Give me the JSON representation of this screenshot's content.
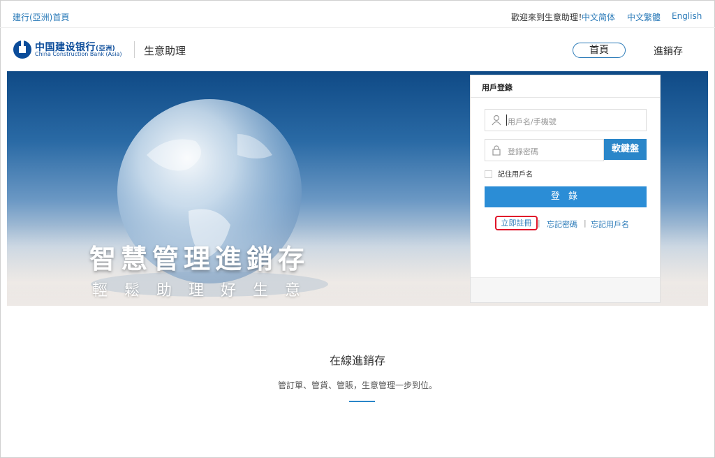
{
  "topbar": {
    "home_link": "建行(亞洲)首頁",
    "welcome": "歡迎來到生意助理！",
    "languages": [
      "中文简体",
      "中文繁體",
      "English"
    ]
  },
  "header": {
    "logo_cn": "中国建设银行",
    "logo_cn_suffix": "(亞洲)",
    "logo_en": "China Construction Bank (Asia)",
    "app_name": "生意助理",
    "nav": [
      "首頁",
      "進銷存"
    ]
  },
  "banner": {
    "title": "智慧管理進銷存",
    "subtitle": "輕鬆助理好生意"
  },
  "login": {
    "title": "用戶登錄",
    "username_placeholder": "用戶名/手機號",
    "password_placeholder": "登錄密碼",
    "virtual_keyboard": "軟鍵盤",
    "remember": "記住用戶名",
    "submit": "登 錄",
    "register": "立即註冊",
    "forgot_password": "忘記密碼",
    "forgot_username": "忘記用戶名",
    "separator": "|"
  },
  "section": {
    "title": "在線進銷存",
    "description": "管訂單、管貨、管賬，生意管理一步到位。"
  },
  "colors": {
    "accent": "#2b8dd6",
    "link": "#2a7ab8",
    "highlight": "#e0142a"
  }
}
